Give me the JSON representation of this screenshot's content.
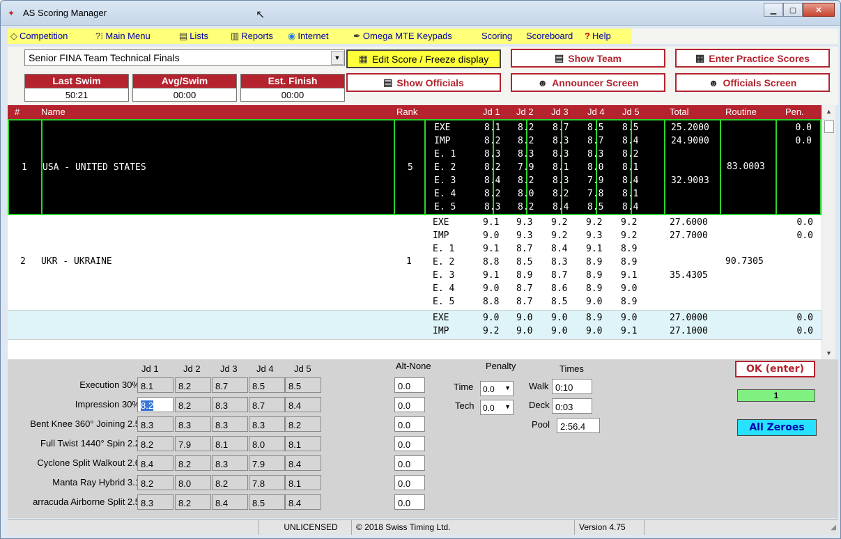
{
  "window": {
    "title": "AS Scoring Manager"
  },
  "menu": [
    {
      "label": "Competition",
      "icon": "checkmark-diamond-icon",
      "underline": "C",
      "rest": "ompetition"
    },
    {
      "label": "Main Menu",
      "icon": "question-tree-icon",
      "underline": "M",
      "rest": "ain Menu"
    },
    {
      "label": "Lists",
      "icon": "list-doc-icon",
      "underline": "L",
      "rest": "ists"
    },
    {
      "label": "Reports",
      "icon": "report-icon",
      "underline": "R",
      "rest": "eports"
    },
    {
      "label": "Internet",
      "icon": "globe-icon",
      "underline": "I",
      "rest": "nternet"
    },
    {
      "label": "Omega MTE Keypads",
      "icon": "pen-icon",
      "underline": "O",
      "rest": "mega MTE Keypads"
    },
    {
      "label": "Scoring",
      "underline": "S",
      "rest": "coring"
    },
    {
      "label": "Scoreboard",
      "underline": "",
      "rest": "Scoreboard"
    },
    {
      "label": "Help",
      "icon": "help-icon",
      "underline": "H",
      "rest": "elp"
    }
  ],
  "toolbar": {
    "event": "Senior FINA Team Technical Finals",
    "edit_score": "Edit Score / Freeze display",
    "show_team": "Show Team",
    "enter_practice": "Enter Practice Scores",
    "show_officials": "Show Officials",
    "announcer_screen": "Announcer Screen",
    "officials_screen": "Officials Screen",
    "stats": [
      {
        "label": "Last Swim",
        "value": "50:21"
      },
      {
        "label": "Avg/Swim",
        "value": "00:00"
      },
      {
        "label": "Est. Finish",
        "value": "00:00"
      }
    ]
  },
  "grid": {
    "headers": [
      "#",
      "Name",
      "Rank",
      "Jd 1",
      "Jd 2",
      "Jd 3",
      "Jd 4",
      "Jd 5",
      "Total",
      "Routine",
      "Pen."
    ],
    "teams": [
      {
        "num": "1",
        "name": "USA - UNITED STATES",
        "rank": "5",
        "routine": "83.0003",
        "rows": [
          {
            "el": "EXE",
            "j": [
              "8.1",
              "8.2",
              "8.7",
              "8.5",
              "8.5"
            ],
            "total": "25.2000",
            "pen": "0.0"
          },
          {
            "el": "IMP",
            "j": [
              "8.2",
              "8.2",
              "8.3",
              "8.7",
              "8.4"
            ],
            "total": "24.9000",
            "pen": "0.0"
          },
          {
            "el": "E. 1",
            "j": [
              "8.3",
              "8.3",
              "8.3",
              "8.3",
              "8.2"
            ],
            "total": "",
            "pen": ""
          },
          {
            "el": "E. 2",
            "j": [
              "8.2",
              "7.9",
              "8.1",
              "8.0",
              "8.1"
            ],
            "total": "",
            "pen": ""
          },
          {
            "el": "E. 3",
            "j": [
              "8.4",
              "8.2",
              "8.3",
              "7.9",
              "8.4"
            ],
            "total": "32.9003",
            "pen": ""
          },
          {
            "el": "E. 4",
            "j": [
              "8.2",
              "8.0",
              "8.2",
              "7.8",
              "8.1"
            ],
            "total": "",
            "pen": ""
          },
          {
            "el": "E. 5",
            "j": [
              "8.3",
              "8.2",
              "8.4",
              "8.5",
              "8.4"
            ],
            "total": "",
            "pen": ""
          }
        ]
      },
      {
        "num": "2",
        "name": "UKR - UKRAINE",
        "rank": "1",
        "routine": "90.7305",
        "rows": [
          {
            "el": "EXE",
            "j": [
              "9.1",
              "9.3",
              "9.2",
              "9.2",
              "9.2"
            ],
            "total": "27.6000",
            "pen": "0.0"
          },
          {
            "el": "IMP",
            "j": [
              "9.0",
              "9.3",
              "9.2",
              "9.3",
              "9.2"
            ],
            "total": "27.7000",
            "pen": "0.0"
          },
          {
            "el": "E. 1",
            "j": [
              "9.1",
              "8.7",
              "8.4",
              "9.1",
              "8.9"
            ],
            "total": "",
            "pen": ""
          },
          {
            "el": "E. 2",
            "j": [
              "8.8",
              "8.5",
              "8.3",
              "8.9",
              "8.9"
            ],
            "total": "",
            "pen": ""
          },
          {
            "el": "E. 3",
            "j": [
              "9.1",
              "8.9",
              "8.7",
              "8.9",
              "9.1"
            ],
            "total": "35.4305",
            "pen": ""
          },
          {
            "el": "E. 4",
            "j": [
              "9.0",
              "8.7",
              "8.6",
              "8.9",
              "9.0"
            ],
            "total": "",
            "pen": ""
          },
          {
            "el": "E. 5",
            "j": [
              "8.8",
              "8.7",
              "8.5",
              "9.0",
              "8.9"
            ],
            "total": "",
            "pen": ""
          }
        ]
      },
      {
        "num": "",
        "name": "",
        "rank": "",
        "routine": "",
        "rows": [
          {
            "el": "EXE",
            "j": [
              "9.0",
              "9.0",
              "9.0",
              "8.9",
              "9.0"
            ],
            "total": "27.0000",
            "pen": "0.0"
          },
          {
            "el": "IMP",
            "j": [
              "9.2",
              "9.0",
              "9.0",
              "9.0",
              "9.1"
            ],
            "total": "27.1000",
            "pen": "0.0"
          }
        ]
      }
    ]
  },
  "entry": {
    "judge_headers": [
      "Jd 1",
      "Jd 2",
      "Jd 3",
      "Jd 4",
      "Jd 5"
    ],
    "alt_label": "Alt-None",
    "penalty_label": "Penalty",
    "times_label": "Times",
    "rows": [
      {
        "label": "Execution 30%",
        "scores": [
          "8.1",
          "8.2",
          "8.7",
          "8.5",
          "8.5"
        ],
        "alt": "0.0"
      },
      {
        "label": "Impression 30%",
        "scores": [
          "8.2",
          "8.2",
          "8.3",
          "8.7",
          "8.4"
        ],
        "alt": "0.0"
      },
      {
        "label": "Bent Knee 360° Joining 2.5",
        "scores": [
          "8.3",
          "8.3",
          "8.3",
          "8.3",
          "8.2"
        ],
        "alt": "0.0"
      },
      {
        "label": "Full Twist 1440° Spin 2.2",
        "scores": [
          "8.2",
          "7.9",
          "8.1",
          "8.0",
          "8.1"
        ],
        "alt": "0.0"
      },
      {
        "label": "Cyclone Split Walkout 2.6",
        "scores": [
          "8.4",
          "8.2",
          "8.3",
          "7.9",
          "8.4"
        ],
        "alt": "0.0"
      },
      {
        "label": "Manta Ray Hybrid 3.1",
        "scores": [
          "8.2",
          "8.0",
          "8.2",
          "7.8",
          "8.1"
        ],
        "alt": "0.0"
      },
      {
        "label": "arracuda Airborne Split 2.5",
        "scores": [
          "8.3",
          "8.2",
          "8.4",
          "8.5",
          "8.4"
        ],
        "alt": "0.0"
      }
    ],
    "penalty_time_label": "Time",
    "penalty_time": "0.0",
    "penalty_tech_label": "Tech",
    "penalty_tech": "0.0",
    "walk_label": "Walk",
    "walk": "0:10",
    "deck_label": "Deck",
    "deck": "0:03",
    "pool_label": "Pool",
    "pool": "2:56.4",
    "ok": "OK (enter)",
    "counter": "1",
    "all_zeroes": "All Zeroes"
  },
  "status": {
    "license": "UNLICENSED",
    "copyright": "© 2018 Swiss Timing Ltd.",
    "version": "Version 4.75"
  },
  "colors": {
    "accent": "#b4232e",
    "highlight": "#ffff78",
    "selected_team_border": "#2bd42b",
    "cyan_button": "#28e0ff"
  }
}
